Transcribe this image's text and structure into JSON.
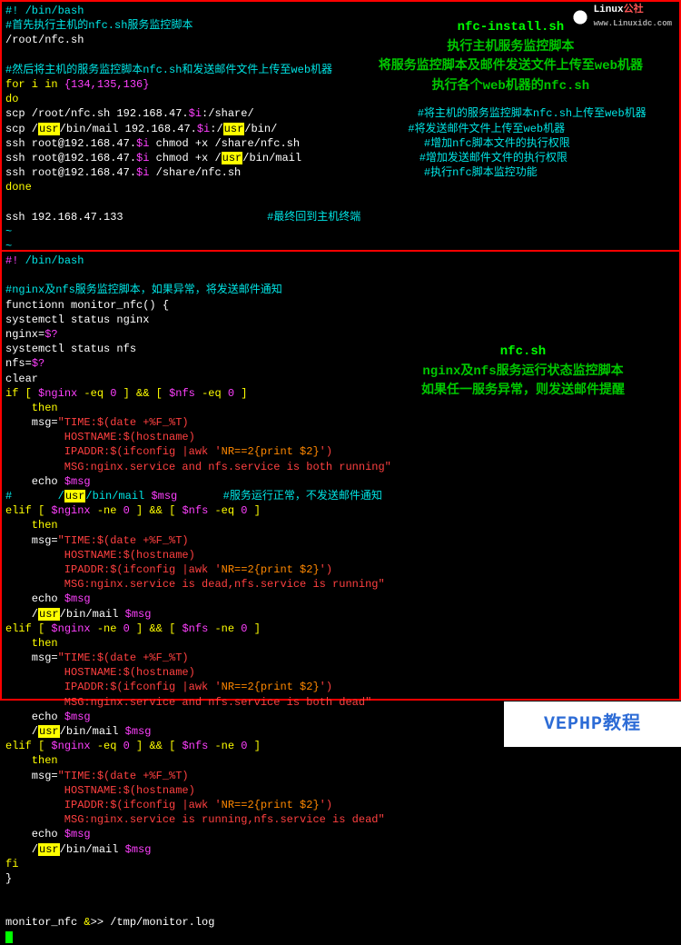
{
  "watermark": {
    "label": "Linux",
    "sub": "公社",
    "url": "www.Linuxidc.com"
  },
  "callout_top": {
    "title": "nfc-install.sh",
    "l1": "执行主机服务监控脚本",
    "l2": "将服务监控脚本及邮件发送文件上传至web机器",
    "l3": "执行各个web机器的nfc.sh"
  },
  "callout_bottom": {
    "title": "nfc.sh",
    "l1": "nginx及nfs服务运行状态监控脚本",
    "l2": "如果任一服务异常，则发送邮件提醒"
  },
  "footer": "VEPHP教程",
  "script1": {
    "shebang": "#! /bin/bash",
    "c1": "#首先执行主机的nfc.sh服务监控脚本",
    "p1": "/root/nfc.sh",
    "c2": "#然后将主机的服务监控脚本nfc.sh和发送邮件文件上传至web机器",
    "for": "for i in ",
    "for_set": "{134,135,136}",
    "do": "do",
    "l1a": "scp /root/nfc.sh 192.168.47.",
    "l1b": "$i",
    "l1c": ":/share/",
    "cm1": "#将主机的服务监控脚本nfc.sh上传至web机器",
    "l2a": "scp /",
    "usr": "usr",
    "l2b": "/bin/mail 192.168.47.",
    "l2c": "$i",
    "l2d": ":/",
    "l2e": "/bin/",
    "cm2": "#将发送邮件文件上传至web机器",
    "l3a": "ssh root@192.168.47.",
    "l3b": "$i",
    "l3c": " chmod +x /share/nfc.sh",
    "cm3": "#增加nfc脚本文件的执行权限",
    "l4a": "ssh root@192.168.47.",
    "l4b": "$i",
    "l4c": " chmod +x /",
    "l4d": "/bin/mail",
    "cm4": "#增加发送邮件文件的执行权限",
    "l5a": "ssh root@192.168.47.",
    "l5b": "$i",
    "l5c": " /share/nfc.sh",
    "cm5": "#执行nfc脚本监控功能",
    "done": "done",
    "sshline": "ssh 192.168.47.133",
    "sshcm": "#最终回到主机终端",
    "tilde": "~"
  },
  "script2": {
    "shebang_h": "#!",
    "shebang_r": " /bin/bash",
    "c1": "#nginx及nfs服务监控脚本，如果异常，将发送邮件通知",
    "fn": "functionn monitor_nfc() {",
    "s1": "systemctl status nginx",
    "ng": "nginx=",
    "q": "$?",
    "s2": "systemctl status nfs",
    "nf": "nfs=",
    "clear": "clear",
    "if1": "if [ ",
    "var_ng": "$nginx",
    "eq0": " -eq ",
    "zero": "0",
    "brk_and": " ] && [ ",
    "var_nf": "$nfs",
    "brk_end": " ]",
    "then": "    then",
    "msg_pre": "    msg=",
    "time": "\"TIME:$(date +%F_%T)",
    "host": "         HOSTNAME:$(hostname)",
    "ip_a": "         IPADDR:$(ifconfig |awk '",
    "ip_awk": "NR==2{print $2}",
    "ip_b": "')",
    "m1": "         MSG:nginx.service and nfs.service is both running\"",
    "m2": "         MSG:nginx.service is dead,nfs.service is running\"",
    "m3": "         MSG:nginx.service and nfs.service is both dead\"",
    "m4": "         MSG:nginx.service is running,nfs.service is dead\"",
    "echo": "    echo ",
    "var_msg": "$msg",
    "hash": "#",
    "mail_sp": "       /",
    "usr": "usr",
    "mail_a": "/bin/mail ",
    "mail_b": "       ",
    "cmm1": "#服务运行正常，不发送邮件通知",
    "elif": "elif [ ",
    "ne0": " -ne ",
    "mail_line_sp": "    /",
    "fi": "fi",
    "brace": "}",
    "call": "monitor_nfc ",
    "amp": "&",
    "redir": ">> /tmp/monitor.log"
  }
}
